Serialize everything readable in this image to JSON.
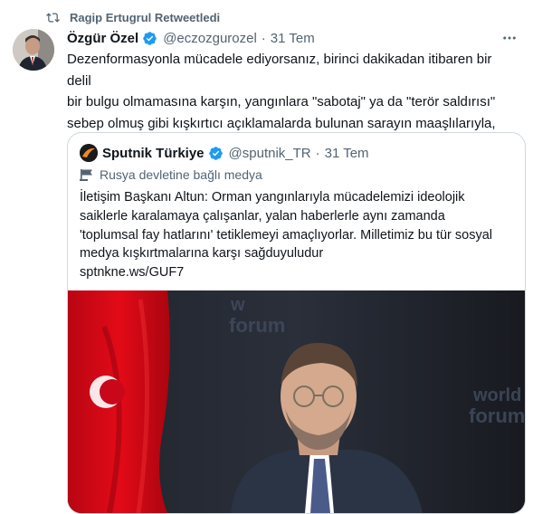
{
  "retweet": {
    "icon": "retweet-icon",
    "text": "Ragip Ertugrul Retweetledi"
  },
  "tweet": {
    "author_name": "Özgür Özel",
    "handle": "@eczozgurozel",
    "separator": "·",
    "date": "31 Tem",
    "more_icon": "more-icon",
    "text": "Dezenformasyonla mücadele ediyorsanız, birinci dakikadan itibaren bir delil\nbir bulgu olmamasına karşın, yangınlara \"sabotaj\" ya da \"terör saldırısı\"\nsebep olmuş gibi kışkırtıcı açıklamalarda bulunan sarayın maaşlılarıyla, AKP\nmilletvekilleriyle de mücadele etmelisiniz."
  },
  "quote": {
    "author_name": "Sputnik Türkiye",
    "handle": "@sputnik_TR",
    "separator": "·",
    "date": "31 Tem",
    "state_label": "Rusya devletine bağlı medya",
    "text": "İletişim Başkanı Altun: Orman yangınlarıyla mücadelemizi ideolojik\nsaiklerle karalamaya çalışanlar, yalan haberlerle aynı zamanda\n'toplumsal fay hatlarını' tetiklemeyi amaçlıyorlar. Milletimiz bu tür sosyal\nmedya kışkırtmalarına karşı sağduyuludur\nsptnkne.ws/GUF7",
    "image_text_1": "w",
    "image_text_2": "forum",
    "image_text_3": "world",
    "image_text_4": "forum"
  },
  "colors": {
    "text": "#0f1419",
    "muted": "#536471",
    "verified": "#1d9bf0",
    "border": "#cfd9de",
    "flag_red": "#e30a17"
  }
}
